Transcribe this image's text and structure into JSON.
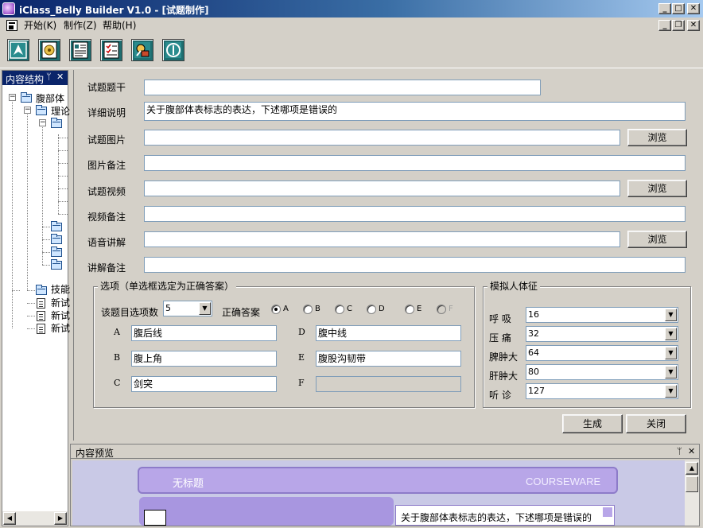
{
  "window": {
    "title": "iClass_Belly Builder V1.0 - [试题制作]"
  },
  "colors": {
    "titlebar_start": "#0a246a",
    "titlebar_end": "#a6caf0",
    "toolbar_icon_bg": "#1e6e70",
    "preview_accent": "#b8a6e8"
  },
  "menu": {
    "items": [
      "开始(K)",
      "制作(Z)",
      "帮助(H)"
    ]
  },
  "toolbar": {
    "buttons": [
      {
        "icon": "navigate-up-icon"
      },
      {
        "icon": "settings-page-icon"
      },
      {
        "icon": "list-page-icon"
      },
      {
        "icon": "checklist-icon"
      },
      {
        "icon": "tools-icon"
      },
      {
        "icon": "info-icon"
      }
    ]
  },
  "sidebar": {
    "title": "内容结构",
    "tree": [
      {
        "label": "腹部体"
      },
      {
        "label": "理论"
      },
      {
        "label": ""
      },
      {
        "label": "技能"
      },
      {
        "label": "新试"
      },
      {
        "label": "新试"
      },
      {
        "label": "新试"
      }
    ]
  },
  "form": {
    "fields": [
      {
        "label": "试题题干",
        "value": ""
      },
      {
        "label": "详细说明",
        "value": "关于腹部体表标志的表达，下述哪项是错误的"
      },
      {
        "label": "试题图片",
        "value": "",
        "browse": "浏览"
      },
      {
        "label": "图片备注",
        "value": ""
      },
      {
        "label": "试题视频",
        "value": "",
        "browse": "浏览"
      },
      {
        "label": "视频备注",
        "value": ""
      },
      {
        "label": "语音讲解",
        "value": "",
        "browse": "浏览"
      },
      {
        "label": "讲解备注",
        "value": ""
      }
    ],
    "options_group": {
      "title": "选项（单选框选定为正确答案）",
      "count_label": "该题目选项数",
      "count_value": "5",
      "answer_label": "正确答案",
      "answer_choices": [
        "A",
        "B",
        "C",
        "D",
        "E",
        "F"
      ],
      "selected_answer": "A",
      "options": [
        {
          "key": "A",
          "value": "腹后线"
        },
        {
          "key": "B",
          "value": "腹上角"
        },
        {
          "key": "C",
          "value": "剑突"
        },
        {
          "key": "D",
          "value": "腹中线"
        },
        {
          "key": "E",
          "value": "腹股沟韧带"
        },
        {
          "key": "F",
          "value": ""
        }
      ]
    },
    "signs_group": {
      "title": "模拟人体征",
      "items": [
        {
          "label": "呼  吸",
          "value": "16"
        },
        {
          "label": "压  痛",
          "value": "32"
        },
        {
          "label": "脾肿大",
          "value": "64"
        },
        {
          "label": "肝肿大",
          "value": "80"
        },
        {
          "label": "听  诊",
          "value": "127"
        }
      ]
    },
    "generate_button": "生成",
    "close_button": "关闭"
  },
  "preview": {
    "title": "内容预览",
    "slide_title": "无标题",
    "brand": "COURSEWARE",
    "snippet": "关于腹部体表标志的表达，下述哪项是错误的"
  }
}
